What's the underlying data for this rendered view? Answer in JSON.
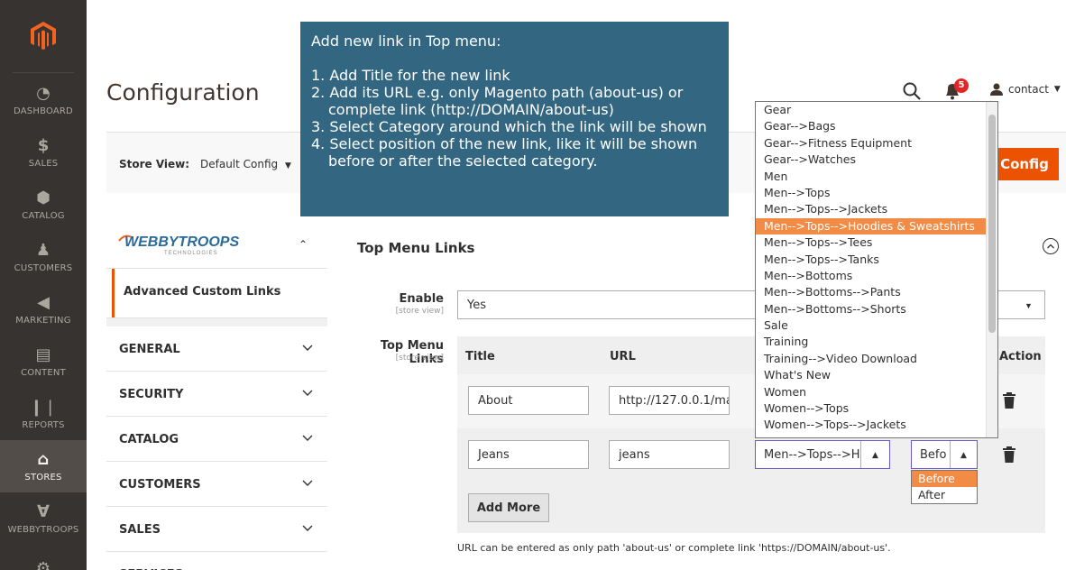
{
  "admin_nav": {
    "items": [
      {
        "label": "DASHBOARD",
        "icon": "dashboard-icon"
      },
      {
        "label": "SALES",
        "icon": "dollar-icon"
      },
      {
        "label": "CATALOG",
        "icon": "cube-icon"
      },
      {
        "label": "CUSTOMERS",
        "icon": "person-icon"
      },
      {
        "label": "MARKETING",
        "icon": "megaphone-icon"
      },
      {
        "label": "CONTENT",
        "icon": "content-icon"
      },
      {
        "label": "REPORTS",
        "icon": "bar-chart-icon"
      },
      {
        "label": "STORES",
        "icon": "store-icon"
      },
      {
        "label": "WEBBYTROOPS",
        "icon": "webbytroops-icon"
      },
      {
        "label": "",
        "icon": "gear-icon"
      }
    ]
  },
  "header": {
    "title": "Configuration",
    "notifications_count": "5",
    "user": "contact"
  },
  "store_bar": {
    "label": "Store View:",
    "value": "Default Config",
    "save_label": "Config"
  },
  "tooltip": {
    "heading": "Add new link in Top menu:",
    "steps": [
      "1. Add Title for the new link",
      "2. Add its URL e.g. only Magento path (about-us) or complete link (http://DOMAIN/about-us)",
      "3. Select Category around which the link will be shown",
      "4. Select position of the new link, like it will be shown before or after the selected category."
    ]
  },
  "sidebar": {
    "brand": "WEBBYTROOPS",
    "brand_sub": "TECHNOLOGIES",
    "active_item": "Advanced Custom Links",
    "sections": [
      "GENERAL",
      "SECURITY",
      "CATALOG",
      "CUSTOMERS",
      "SALES",
      "SERVICES"
    ]
  },
  "main": {
    "section_title": "Top Menu Links",
    "enable_label": "Enable",
    "enable_scope": "[store view]",
    "enable_value": "Yes",
    "links_label": "Top Menu Links",
    "links_scope": "[store view]",
    "columns": [
      "Title",
      "URL",
      "Action"
    ],
    "rows": [
      {
        "title": "About",
        "url": "http://127.0.0.1/ma",
        "category": "",
        "position": ""
      },
      {
        "title": "Jeans",
        "url": "jeans",
        "category": "Men-->Tops-->H",
        "position": "Befo"
      }
    ],
    "add_more": "Add More",
    "note": "URL can be entered as only path 'about-us' or complete link 'https://DOMAIN/about-us'."
  },
  "category_options": [
    "Gear",
    "Gear-->Bags",
    "Gear-->Fitness Equipment",
    "Gear-->Watches",
    "Men",
    "Men-->Tops",
    "Men-->Tops-->Jackets",
    "Men-->Tops-->Hoodies & Sweatshirts",
    "Men-->Tops-->Tees",
    "Men-->Tops-->Tanks",
    "Men-->Bottoms",
    "Men-->Bottoms-->Pants",
    "Men-->Bottoms-->Shorts",
    "Sale",
    "Training",
    "Training-->Video Download",
    "What's New",
    "Women",
    "Women-->Tops",
    "Women-->Tops-->Jackets"
  ],
  "category_selected_index": 7,
  "position_options": [
    "Before",
    "After"
  ],
  "position_selected_index": 0,
  "colors": {
    "nav_bg": "#373330",
    "accent": "#eb5202",
    "tooltip_bg": "#336680",
    "highlight": "#f18b46"
  }
}
